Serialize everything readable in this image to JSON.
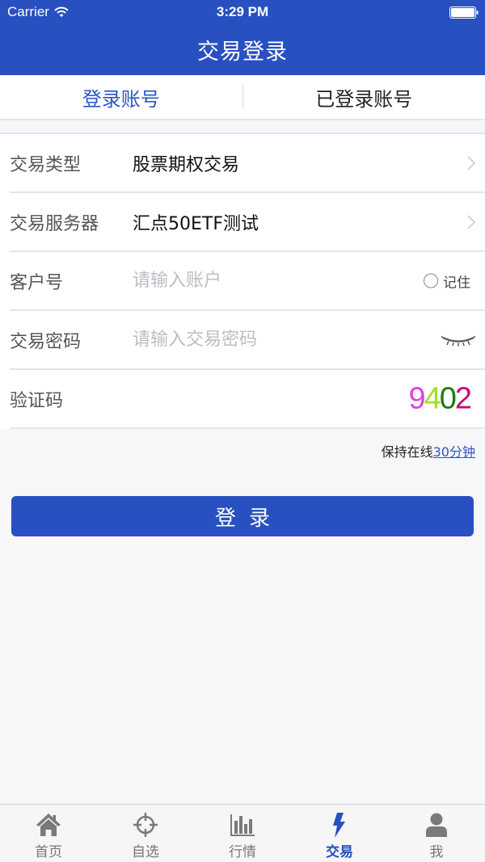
{
  "status_bar": {
    "carrier": "Carrier",
    "time": "3:29 PM"
  },
  "nav": {
    "title": "交易登录"
  },
  "tabs": [
    {
      "label": "登录账号",
      "active": true
    },
    {
      "label": "已登录账号",
      "active": false
    }
  ],
  "form": {
    "trade_type": {
      "label": "交易类型",
      "value": "股票期权交易"
    },
    "server": {
      "label": "交易服务器",
      "value": "汇点50ETF测试"
    },
    "account": {
      "label": "客户号",
      "value": "",
      "placeholder": "请输入账户",
      "remember_label": "记住"
    },
    "password": {
      "label": "交易密码",
      "value": "",
      "placeholder": "请输入交易密码"
    },
    "captcha": {
      "label": "验证码",
      "value": "",
      "digits": [
        {
          "char": "9",
          "color": "#e040e0"
        },
        {
          "char": "4",
          "color": "#a0e020"
        },
        {
          "char": "0",
          "color": "#1a7a10"
        },
        {
          "char": "2",
          "color": "#c0107a"
        }
      ]
    }
  },
  "keep_online": {
    "prefix": "保持在线",
    "link": "30分钟"
  },
  "login_button": {
    "label": "登录"
  },
  "tabbar": [
    {
      "label": "首页",
      "icon": "home-icon",
      "active": false
    },
    {
      "label": "自选",
      "icon": "crosshair-icon",
      "active": false
    },
    {
      "label": "行情",
      "icon": "bar-chart-icon",
      "active": false
    },
    {
      "label": "交易",
      "icon": "lightning-icon",
      "active": true
    },
    {
      "label": "我",
      "icon": "user-icon",
      "active": false
    }
  ],
  "colors": {
    "brand": "#2850c0",
    "accent_text": "#2b55c8"
  }
}
